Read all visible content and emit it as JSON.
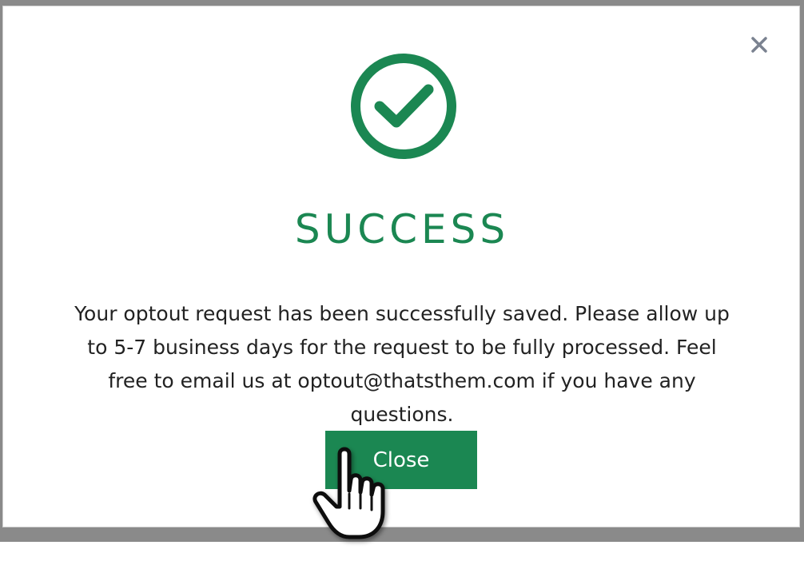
{
  "modal": {
    "close_icon": "close-icon",
    "status_icon": "check-circle-icon",
    "title": "SUCCESS",
    "message": "Your optout request has been successfully saved. Please allow up to 5-7 business days for the request to be fully processed. Feel free to email us at optout@thatsthem.com if you have any questions.",
    "close_button_label": "Close"
  },
  "cursor": {
    "icon": "hand-pointer-icon"
  },
  "colors": {
    "accent": "#1b8752",
    "backdrop": "#8a8a8a",
    "text": "#222222",
    "close_x": "#7a8290"
  }
}
